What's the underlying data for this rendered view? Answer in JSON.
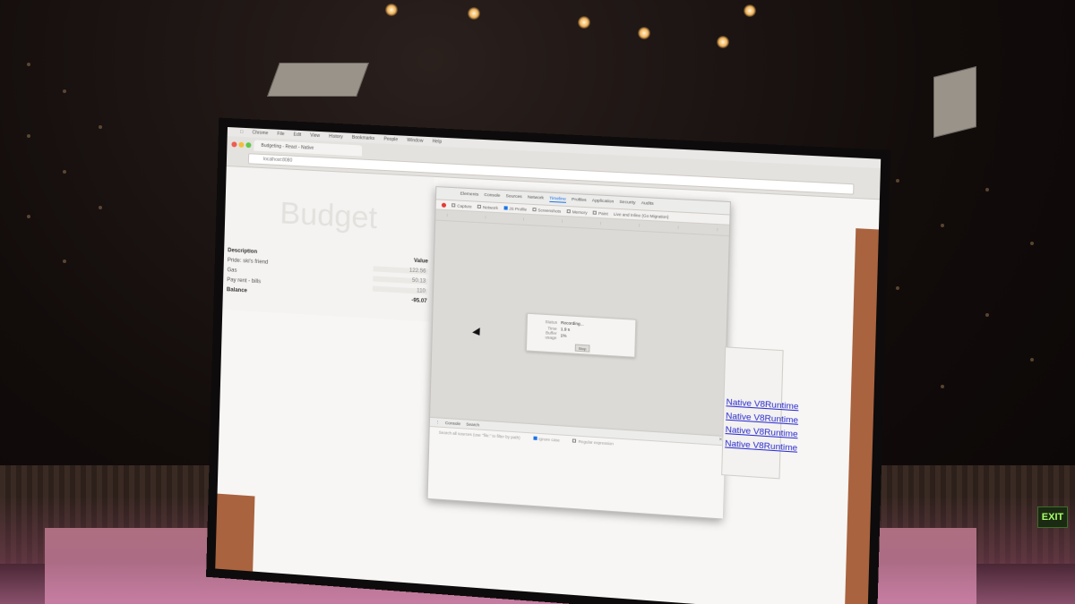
{
  "browser": {
    "menu": [
      "Chrome",
      "File",
      "Edit",
      "View",
      "History",
      "Bookmarks",
      "People",
      "Window",
      "Help"
    ],
    "tab_title": "Budgeting - React - Native",
    "address": "localhost:8080"
  },
  "budget": {
    "title": "Budget",
    "header": {
      "description": "Description",
      "value": "Value"
    },
    "rows": [
      {
        "description": "Pride: ski's friend",
        "value": "122.56"
      },
      {
        "description": "Gas",
        "value": "50.13"
      },
      {
        "description": "Pay rent - bills",
        "value": "110"
      }
    ],
    "balance": {
      "label": "Balance",
      "value": "-95.07"
    }
  },
  "devtools": {
    "tabs": [
      "Elements",
      "Console",
      "Sources",
      "Network",
      "Timeline",
      "Profiles",
      "Application",
      "Security",
      "Audits"
    ],
    "active_tab": "Timeline",
    "toolbar": [
      "Capture",
      "Network",
      "JS Profile",
      "Screenshots",
      "Memory",
      "Paint"
    ],
    "recording_label": "Live and Inline (Go Migration)",
    "dialog": {
      "status_label": "Status",
      "status_value": "Recording...",
      "time_label": "Time",
      "time_value": "1.9 s",
      "buffer_label": "Buffer usage",
      "buffer_value": "1%",
      "stop_label": "Stop"
    },
    "drawer": {
      "tabs": [
        "Console",
        "Search"
      ],
      "search_placeholder": "Search all sources (use \"file:\" to filter by path)",
      "ignore_case": "Ignore case",
      "regex": "Regular expression"
    }
  },
  "links": [
    "Native V8Runtime",
    "Native V8Runtime",
    "Native V8Runtime",
    "Native V8Runtime"
  ],
  "room": {
    "exit_sign": "EXIT"
  },
  "colors": {
    "accent": "#1a73e8",
    "link": "#2a2ad0",
    "record": "#e53935"
  }
}
